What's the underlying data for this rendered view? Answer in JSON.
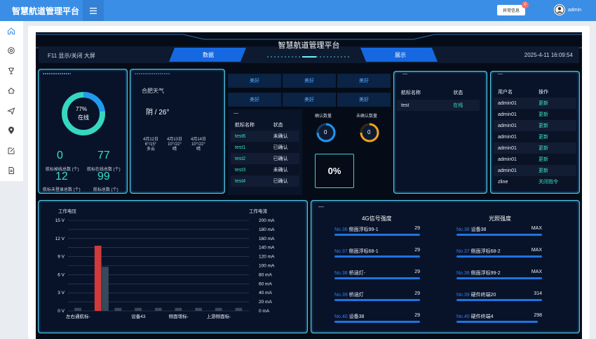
{
  "app": {
    "title": "智慧航道管理平台",
    "menu_icon": "hamburger-icon"
  },
  "header": {
    "alert_label": "异常信息",
    "alert_count": "0",
    "username": "admin"
  },
  "sidebar": {
    "icons": [
      "home-icon",
      "settings-icon",
      "trophy-icon",
      "house-icon",
      "send-icon",
      "location-icon",
      "edit-icon",
      "document-icon"
    ]
  },
  "dashboard": {
    "title": "智慧航道管理平台",
    "f11_hint": "F11 显示/关闭 大屏",
    "datetime": "2025-4-11 16:09:54",
    "nav": {
      "data_label": "数据",
      "display_label": "展示"
    }
  },
  "online": {
    "percent_text": "77%",
    "percent": 0.77,
    "status": "在线",
    "stats": [
      {
        "value": "0",
        "label": "航标掉线总数 (个)"
      },
      {
        "value": "77",
        "label": "航标在线总数 (个)"
      },
      {
        "value": "12",
        "label": "航标未登录总数 (个)"
      },
      {
        "value": "99",
        "label": "航标总数 (个)"
      }
    ]
  },
  "weather": {
    "city": "合肥天气",
    "today": "阴 / 26°",
    "forecast": [
      {
        "date": "4月12日",
        "temp": "6°/15°",
        "cond": "多云"
      },
      {
        "date": "4月13日",
        "temp": "10°/22°",
        "cond": "晴"
      },
      {
        "date": "4月14日",
        "temp": "10°/22°",
        "cond": "晴"
      }
    ]
  },
  "quality": [
    "美好",
    "美好",
    "美好",
    "美好",
    "美好",
    "美好"
  ],
  "confirm": {
    "dash": "—",
    "headers": [
      "航标名称",
      "状态"
    ],
    "rows": [
      {
        "name": "test6",
        "status": "未确认"
      },
      {
        "name": "test1",
        "status": "已确认"
      },
      {
        "name": "test2",
        "status": "已确认"
      },
      {
        "name": "test3",
        "status": "未确认"
      },
      {
        "name": "test4",
        "status": "已确认"
      }
    ],
    "confirmed_label": "确认数量",
    "confirmed_value": "0",
    "unconfirmed_label": "未确认数量",
    "unconfirmed_value": "0",
    "ratio": "0%"
  },
  "beacon_status": {
    "dash": "—",
    "headers": [
      "航标名称",
      "状态"
    ],
    "rows": [
      {
        "name": "test",
        "status": "在线"
      }
    ]
  },
  "users": {
    "dash": "—",
    "headers": [
      "用户名",
      "操作"
    ],
    "rows": [
      {
        "name": "admin01",
        "op": "更新"
      },
      {
        "name": "admin01",
        "op": "更新"
      },
      {
        "name": "admin01",
        "op": "更新"
      },
      {
        "name": "admin01",
        "op": "更新"
      },
      {
        "name": "admin01",
        "op": "更新"
      },
      {
        "name": "admin01",
        "op": "更新"
      },
      {
        "name": "admin01",
        "op": "更新"
      },
      {
        "name": "zline",
        "op": "关闭指令"
      }
    ]
  },
  "chart_data": {
    "type": "bar",
    "ylabel": "工作电压",
    "y2label": "工作电流",
    "ylim": [
      0,
      15
    ],
    "y2lim": [
      0,
      200
    ],
    "yticks": [
      "0 V",
      "3 V",
      "6 V",
      "9 V",
      "12 V",
      "15 V"
    ],
    "y2ticks": [
      "0 mA",
      "20 mA",
      "40 mA",
      "60 mA",
      "80 mA",
      "100 mA",
      "120 mA",
      "140 mA",
      "160 mA",
      "180 mA",
      "200 mA"
    ],
    "categories": [
      "左右通航标-",
      "",
      "",
      "设备43",
      "",
      "侧面增标-",
      "",
      "上游侧面标-",
      ""
    ],
    "series": [
      {
        "values": [
          0.5,
          10.8,
          0.5,
          0.5,
          0.5,
          0.5,
          0.5,
          0.5,
          0.5
        ],
        "color": "#d03a3a"
      },
      {
        "values": [
          0,
          7.3,
          0,
          0,
          0,
          0,
          0,
          0,
          0
        ],
        "color": "#37495a"
      }
    ],
    "highlight_index": 1,
    "grid": true
  },
  "signal": {
    "dash": "—",
    "g4_title": "4G信号强度",
    "light_title": "光照强度",
    "g4": [
      {
        "no": "No.36",
        "name": "侧面浮标99-1",
        "value": "29",
        "level": 1.0
      },
      {
        "no": "No.37",
        "name": "侧面浮标68-1",
        "value": "29",
        "level": 1.0
      },
      {
        "no": "No.38",
        "name": "桥涵灯-",
        "value": "29",
        "level": 1.0
      },
      {
        "no": "No.39",
        "name": "桥涵灯",
        "value": "29",
        "level": 1.0
      },
      {
        "no": "No.40",
        "name": "设备38",
        "value": "29",
        "level": 1.0
      }
    ],
    "light": [
      {
        "no": "No.36",
        "name": "设备38",
        "value": "MAX",
        "level": 1.0
      },
      {
        "no": "No.37",
        "name": "侧面浮标68-2",
        "value": "MAX",
        "level": 1.0
      },
      {
        "no": "No.38",
        "name": "侧面浮标99-2",
        "value": "MAX",
        "level": 1.0
      },
      {
        "no": "No.39",
        "name": "硬件终端20",
        "value": "314",
        "level": 1.0
      },
      {
        "no": "No.40",
        "name": "硬件终端4",
        "value": "298",
        "level": 0.95
      }
    ]
  }
}
